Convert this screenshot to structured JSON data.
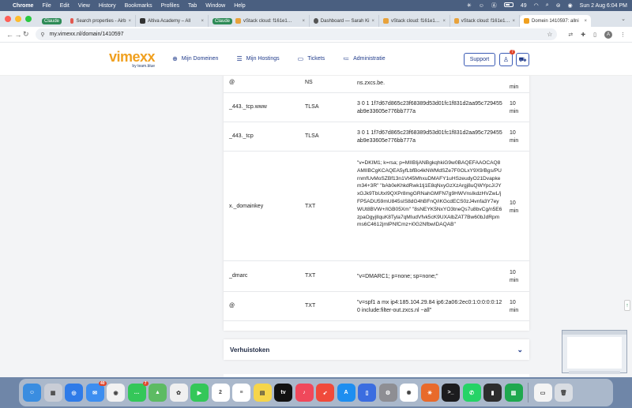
{
  "menubar": {
    "app": "Chrome",
    "items": [
      "File",
      "Edit",
      "View",
      "History",
      "Bookmarks",
      "Profiles",
      "Tab",
      "Window",
      "Help"
    ],
    "battery": "49",
    "datetime": "Sun 2 Aug  6:04 PM"
  },
  "tabs": [
    {
      "group": "Claude",
      "label": "Claude",
      "color": "#d97757"
    },
    {
      "label": "Search properties - Airb",
      "color": "#e2584f"
    },
    {
      "label": "Altiva Academy – All",
      "color": "#333333"
    },
    {
      "group": "Claude",
      "label": "vStack cloud: f161e1…",
      "color": "#e8a23b"
    },
    {
      "label": "Dashboard — Sarah Ki",
      "color": "#555555"
    },
    {
      "label": "vStack cloud: f161e1…",
      "color": "#e8a23b"
    },
    {
      "label": "vStack cloud: f161e1…",
      "color": "#e8a23b"
    },
    {
      "label": "Domein 1410597: allni",
      "color": "#f0a01f",
      "active": true
    }
  ],
  "urlbar": {
    "url": "my.vimexx.nl/domain/1410597"
  },
  "site": {
    "logo": "vimexx",
    "logo_sub": "by team.blue",
    "nav": [
      {
        "icon": "globe-icon",
        "label": "Mijn Domeinen"
      },
      {
        "icon": "list-icon",
        "label": "Mijn Hostings"
      },
      {
        "icon": "ticket-icon",
        "label": "Tickets"
      },
      {
        "icon": "admin-icon",
        "label": "Administratie"
      }
    ],
    "support": "Support",
    "notif_count": "7"
  },
  "dns_records": [
    {
      "name": "@",
      "type": "NS",
      "value": "ns.zxcs.be.",
      "ttl": "min"
    },
    {
      "name": "_443._tcp.www",
      "type": "TLSA",
      "value": "3 0 1 1f7d67d865c23f68389d53d01fc1f831d2aa95c729455ab9e33605e776bb777a",
      "ttl": "10 min"
    },
    {
      "name": "_443._tcp",
      "type": "TLSA",
      "value": "3 0 1 1f7d67d865c23f68389d53d01fc1f831d2aa95c729455ab9e33605e776bb777a",
      "ttl": "10 min"
    },
    {
      "name": "x._domainkey",
      "type": "TXT",
      "value": "\"v=DKIM1; k=rsa; p=MIIBIjANBgkqhkiG9w0BAQEFAAOCAQ8AMIIBCgKCAQEA5yfLbfBo4kNWMdSZe7F0OLxY9X9/Bgs/PUrnmfUvMoSZBf13n1Vt45MhxuDMAFY1uHSzeudyO21Dvapkem34+3R\" \"bAb0eKhkdRwk1tj1E8qNxyGzXzArgj8uQWYpcJ/JYxGJk9TbUtxI9QXPr8mgGRNahGMFN7g9HWVnsIkdzHVZwL/jFP5ADU59mU845sIS8dG4hBFnQ/iKGcdECS0zJ4vnfa3Y7eyWUt8BVW+/IGB05Xm\" \"8sNEYK5NxYO3tneQs7u8bvCg/n5E6zpaOgyjlIquK8Tyla7qMIudVfvk5cK9UXAlbZAT7Bw60bJdRpmms6C4612jmlPNfCmz+i0G2NfbwIDAQAB\"",
      "ttl": "10 min"
    },
    {
      "name": "_dmarc",
      "type": "TXT",
      "value": "\"v=DMARC1; p=none; sp=none;\"",
      "ttl": "10 min"
    },
    {
      "name": "@",
      "type": "TXT",
      "value": "\"v=spf1 a mx ip4:185.104.29.84 ip6:2a06:2ec0:1:0:0:0:0:120 include:filter-out.zxcs.nl ~all\"",
      "ttl": "10 min"
    }
  ],
  "accordion": {
    "title": "Verhuistoken"
  },
  "dock": {
    "apps": [
      {
        "name": "Finder",
        "color": "#3a8de0",
        "glyph": "☺"
      },
      {
        "name": "Launchpad",
        "color": "#c9cdd6",
        "glyph": "▦"
      },
      {
        "name": "Safari",
        "color": "#2f7be8",
        "glyph": "◎"
      },
      {
        "name": "Mail",
        "color": "#3d8ef0",
        "glyph": "✉",
        "badge": "40"
      },
      {
        "name": "Chrome",
        "color": "#f2f2f2",
        "glyph": "◉"
      },
      {
        "name": "Messages",
        "color": "#34c759",
        "glyph": "…",
        "badge": "7"
      },
      {
        "name": "Maps",
        "color": "#5dbb63",
        "glyph": "▲"
      },
      {
        "name": "Photos",
        "color": "#f0f0f0",
        "glyph": "✿"
      },
      {
        "name": "FaceTime",
        "color": "#34c759",
        "glyph": "▶"
      },
      {
        "name": "Calendar",
        "color": "#ffffff",
        "glyph": "2"
      },
      {
        "name": "Reminders",
        "color": "#ffffff",
        "glyph": "≡"
      },
      {
        "name": "Notes",
        "color": "#f6d54a",
        "glyph": "▤"
      },
      {
        "name": "Apple TV",
        "color": "#111111",
        "glyph": "tv"
      },
      {
        "name": "Music",
        "color": "#f0485b",
        "glyph": "♪"
      },
      {
        "name": "Rocket",
        "color": "#f04a3b",
        "glyph": "➶"
      },
      {
        "name": "App Store",
        "color": "#1e8ef0",
        "glyph": "A"
      },
      {
        "name": "Simulator",
        "color": "#3b6de0",
        "glyph": "▯"
      },
      {
        "name": "System Settings",
        "color": "#8e8e93",
        "glyph": "⚙"
      },
      {
        "name": "ChatGPT",
        "color": "#ffffff",
        "glyph": "✺"
      },
      {
        "name": "Perplexity",
        "color": "#e86a2b",
        "glyph": "✳"
      },
      {
        "name": "Terminal",
        "color": "#1c1c1e",
        "glyph": ">_"
      },
      {
        "name": "WhatsApp",
        "color": "#25d366",
        "glyph": "✆"
      },
      {
        "name": "Activity Monitor",
        "color": "#2d2d2d",
        "glyph": "▮"
      },
      {
        "name": "Numbers",
        "color": "#1fa84f",
        "glyph": "▥"
      },
      {
        "name": "Document",
        "color": "#f4f4f4",
        "glyph": "▭"
      },
      {
        "name": "Trash",
        "color": "#d9dde3",
        "glyph": "🗑"
      }
    ]
  }
}
